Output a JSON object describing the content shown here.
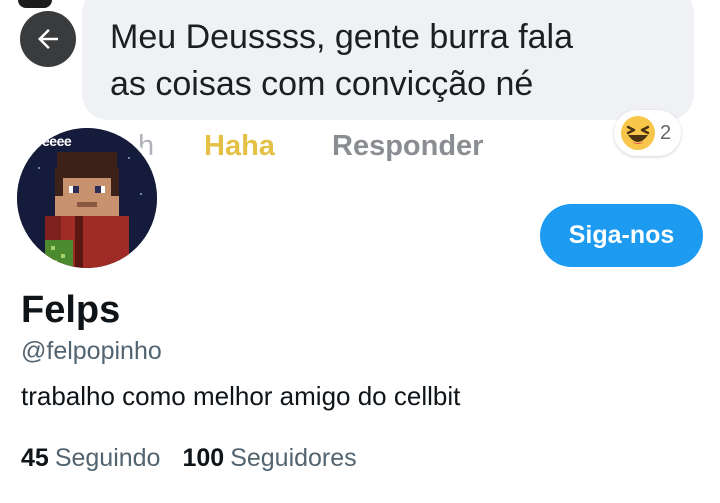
{
  "facebook_comment": {
    "text_line1": "Meu Deussss, gente burra fala",
    "text_line2": "as coisas com convicção né",
    "time_fragment": "h",
    "haha_label": "Haha",
    "reply_label": "Responder",
    "reaction_icon": "haha-emoji-icon",
    "reaction_count": "2"
  },
  "profile": {
    "avatar_caption": "Teeee",
    "follow_label": "Siga-nos",
    "display_name": "Felps",
    "handle": "@felpopinho",
    "bio": "trabalho como melhor amigo do cellbit",
    "following_count": "45",
    "following_label": "Seguindo",
    "followers_count": "100",
    "followers_label": "Seguidores"
  },
  "colors": {
    "follow_button": "#1d9bf0",
    "haha_yellow": "#e4c044",
    "bubble_gray": "#eff1f4",
    "secondary_text": "#536471"
  }
}
